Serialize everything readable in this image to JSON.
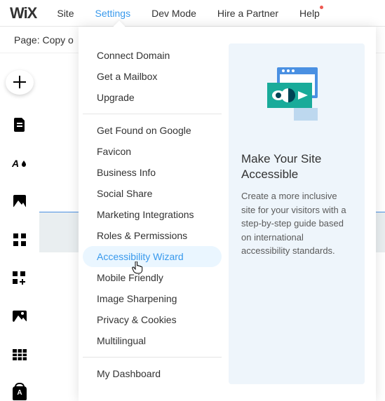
{
  "logo": "WiX",
  "topnav": {
    "site": "Site",
    "settings": "Settings",
    "devmode": "Dev Mode",
    "hire": "Hire a Partner",
    "help": "Help"
  },
  "pagestrip": {
    "label": "Page: Copy o"
  },
  "settings_menu": {
    "group1": {
      "connect_domain": "Connect Domain",
      "get_mailbox": "Get a Mailbox",
      "upgrade": "Upgrade"
    },
    "group2": {
      "get_found": "Get Found on Google",
      "favicon": "Favicon",
      "business_info": "Business Info",
      "social_share": "Social Share",
      "marketing": "Marketing Integrations",
      "roles": "Roles & Permissions",
      "accessibility": "Accessibility Wizard",
      "mobile": "Mobile Friendly",
      "sharpening": "Image Sharpening",
      "privacy": "Privacy & Cookies",
      "multilingual": "Multilingual"
    },
    "group3": {
      "dashboard": "My Dashboard"
    }
  },
  "info_panel": {
    "title": "Make Your Site Accessible",
    "body": "Create a more inclusive site for your visitors with a step-by-step guide based on international accessibility standards."
  },
  "colors": {
    "accent": "#3899ec",
    "illus_teal": "#19ab9a",
    "illus_browser": "#4a90e2",
    "info_bg": "#eef5fb",
    "alert_dot": "#ee5951"
  }
}
